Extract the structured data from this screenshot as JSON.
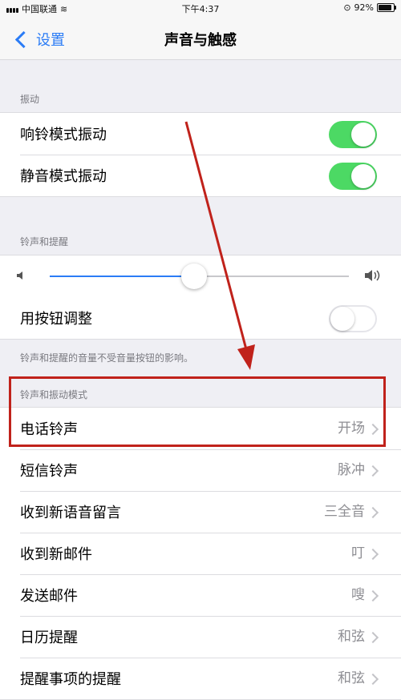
{
  "status_bar": {
    "carrier": "中国联通",
    "time": "下午4:37",
    "battery": "92%",
    "battery_level": 0.92
  },
  "nav": {
    "back_label": "设置",
    "title": "声音与触感"
  },
  "vibration": {
    "header": "振动",
    "rows": [
      {
        "label": "响铃模式振动",
        "on": true
      },
      {
        "label": "静音模式振动",
        "on": true
      }
    ]
  },
  "ringer": {
    "header": "铃声和提醒",
    "volume_level": 0.45,
    "change_with_buttons": {
      "label": "用按钮调整",
      "on": false
    },
    "footnote": "铃声和提醒的音量不受音量按钮的影响。"
  },
  "sounds": {
    "header": "铃声和振动模式",
    "rows": [
      {
        "label": "电话铃声",
        "value": "开场"
      },
      {
        "label": "短信铃声",
        "value": "脉冲"
      },
      {
        "label": "收到新语音留言",
        "value": "三全音"
      },
      {
        "label": "收到新邮件",
        "value": "叮"
      },
      {
        "label": "发送邮件",
        "value": "嗖"
      },
      {
        "label": "日历提醒",
        "value": "和弦"
      },
      {
        "label": "提醒事项的提醒",
        "value": "和弦"
      }
    ]
  },
  "colors": {
    "accent": "#2b7cf6",
    "toggle_on": "#4cd964",
    "annotation": "#c0221b"
  }
}
